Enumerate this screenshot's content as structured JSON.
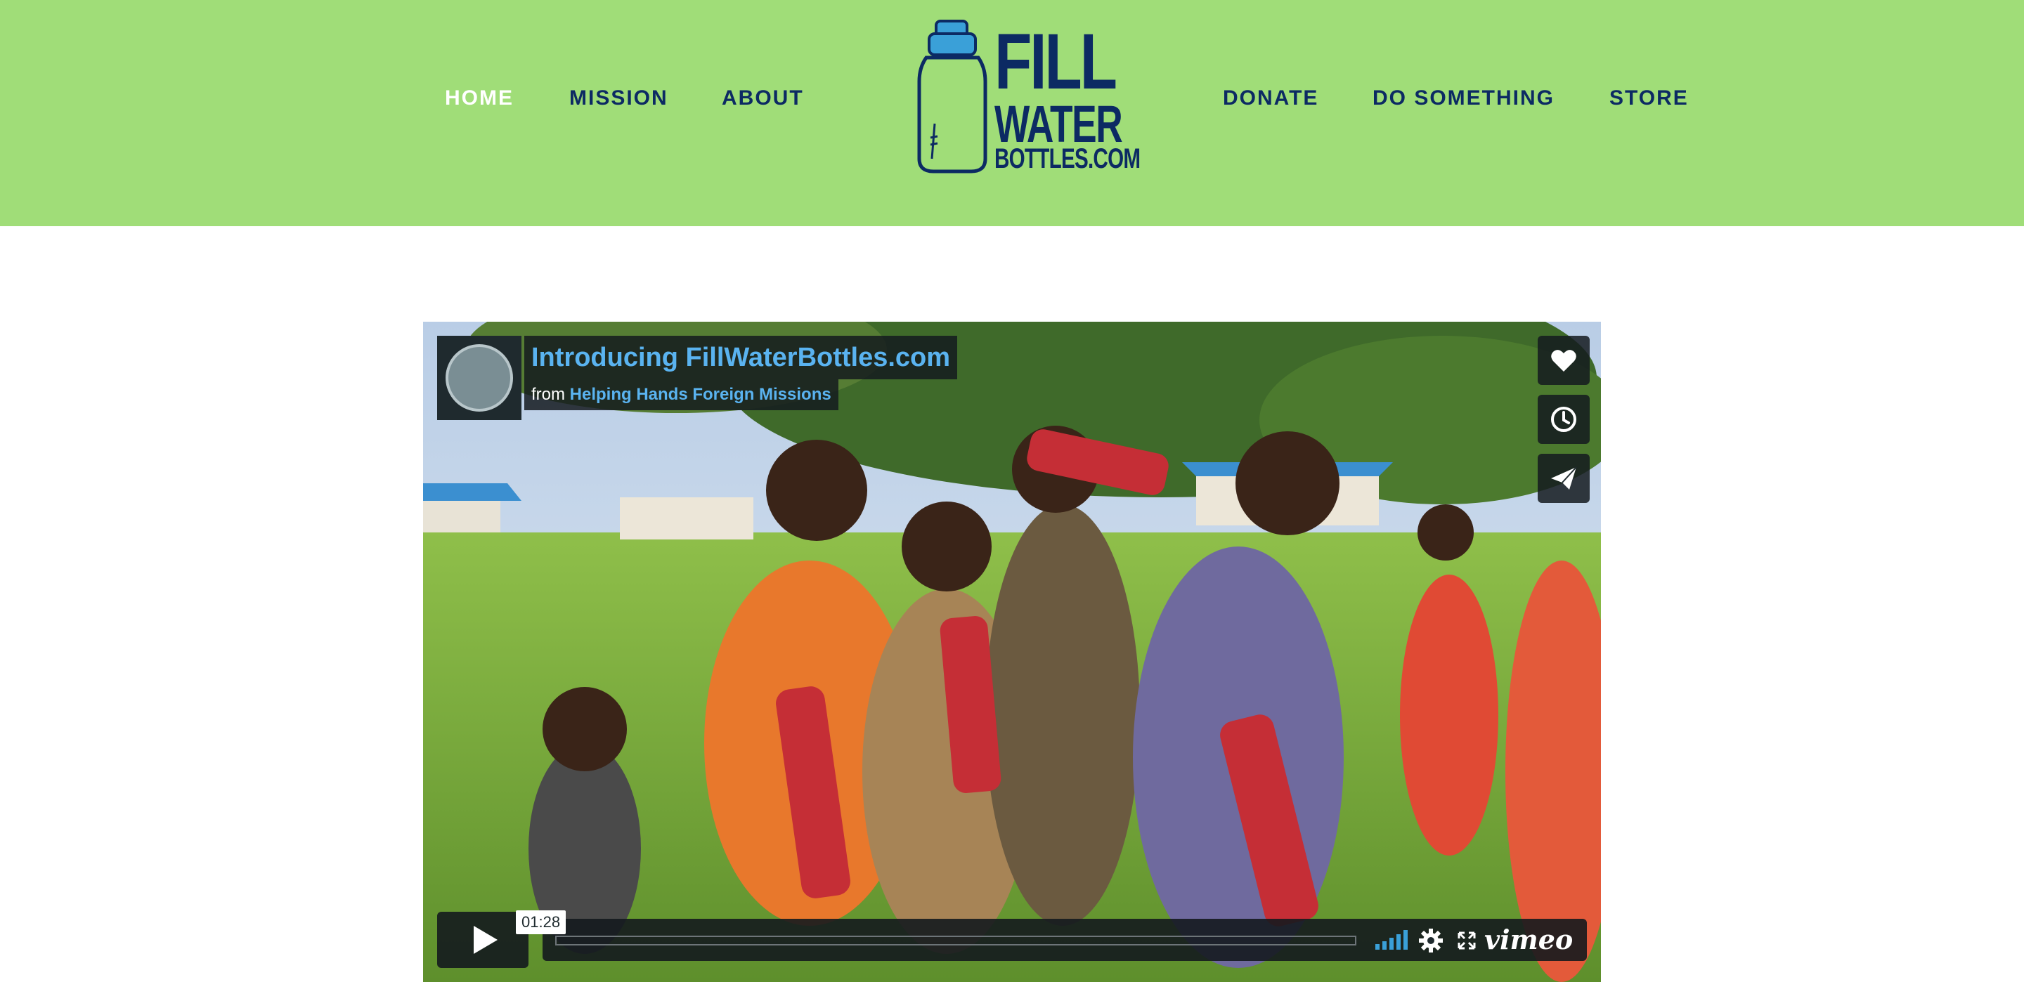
{
  "nav": {
    "left": [
      {
        "label": "HOME",
        "active": true
      },
      {
        "label": "MISSION",
        "active": false
      },
      {
        "label": "ABOUT",
        "active": false
      }
    ],
    "right": [
      {
        "label": "DONATE"
      },
      {
        "label": "DO SOMETHING"
      },
      {
        "label": "STORE"
      }
    ]
  },
  "logo": {
    "line1": "FILL",
    "line2": "WATER",
    "line3": "BOTTLES.COM"
  },
  "video": {
    "title": "Introducing FillWaterBottles.com",
    "from_prefix": "from",
    "channel": "Helping Hands Foreign Missions",
    "duration": "01:28",
    "provider": "vimeo",
    "icons": [
      "heart-icon",
      "clock-icon",
      "paper-plane-icon",
      "play-icon",
      "volume-icon",
      "gear-icon",
      "fullscreen-icon"
    ]
  },
  "colors": {
    "header_bg": "#a0dd78",
    "nav_text": "#0c2a63",
    "nav_active": "#ffffff",
    "vimeo_accent": "#5ab3f0"
  }
}
